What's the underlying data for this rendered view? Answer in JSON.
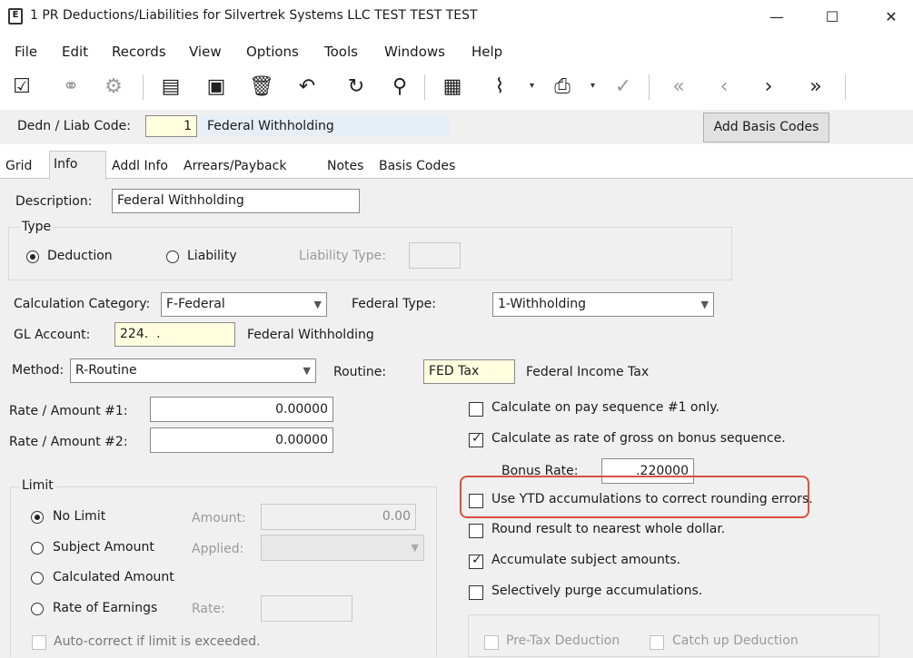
{
  "window": {
    "title": "1 PR Deductions/Liabilities for Silvertrek Systems LLC TEST TEST TEST",
    "minimize": "—",
    "maximize": "☐",
    "close": "✕"
  },
  "menu": [
    "File",
    "Edit",
    "Records",
    "View",
    "Options",
    "Tools",
    "Windows",
    "Help"
  ],
  "toolbar": {
    "icons": [
      "edit-icon",
      "binoculars-icon",
      "settings-gear-icon",
      "new-document-icon",
      "save-icon",
      "delete-icon",
      "undo-icon",
      "refresh-icon",
      "search-icon",
      "grid-icon",
      "attach-icon",
      "print-icon",
      "spellcheck-icon",
      "first-record-icon",
      "previous-record-icon",
      "next-record-icon",
      "last-record-icon"
    ]
  },
  "header": {
    "dedn_label": "Dedn / Liab Code:",
    "dedn_code": "1",
    "dedn_name": "Federal Withholding",
    "add_basis_codes": "Add Basis Codes"
  },
  "tabs": [
    "Grid",
    "Info",
    "Addl Info",
    "Arrears/Payback",
    "Notes",
    "Basis Codes"
  ],
  "active_tab": "Info",
  "form": {
    "description_label": "Description:",
    "description_value": "Federal Withholding",
    "type_group": "Type",
    "deduction_label": "Deduction",
    "liability_label": "Liability",
    "liability_type_label": "Liability Type:",
    "calc_category_label": "Calculation Category:",
    "calc_category_value": "F-Federal",
    "federal_type_label": "Federal Type:",
    "federal_type_value": "1-Withholding",
    "gl_account_label": "GL Account:",
    "gl_account_value": "224.  .",
    "gl_account_desc": "Federal Withholding",
    "method_label": "Method:",
    "method_value": "R-Routine",
    "routine_label": "Routine:",
    "routine_value": "FED Tax",
    "routine_desc": "Federal Income Tax",
    "rate1_label": "Rate / Amount #1:",
    "rate1_value": "0.00000",
    "rate2_label": "Rate / Amount #2:",
    "rate2_value": "0.00000",
    "limit_group": "Limit",
    "no_limit": "No Limit",
    "subject_amount": "Subject Amount",
    "calculated_amount": "Calculated Amount",
    "rate_of_earnings": "Rate of Earnings",
    "amount_label": "Amount:",
    "amount_value": "0.00",
    "applied_label": "Applied:",
    "rate_label": "Rate:",
    "auto_correct": "Auto-correct if limit is exceeded.",
    "calc_pay_seq": "Calculate on pay sequence #1 only.",
    "calc_rate_gross": "Calculate as rate of gross on bonus sequence.",
    "bonus_rate_label": "Bonus Rate:",
    "bonus_rate_value": ".220000",
    "use_ytd": "Use YTD accumulations to correct rounding errors.",
    "round_result": "Round result to nearest whole dollar.",
    "accumulate_subject": "Accumulate subject amounts.",
    "selectively_purge": "Selectively purge accumulations.",
    "pre_tax": "Pre-Tax Deduction",
    "catch_up": "Catch up Deduction"
  },
  "colors": {
    "highlight": "#d9503f",
    "yellow_field": "#ffffe0",
    "panel": "#f0f0f0"
  }
}
